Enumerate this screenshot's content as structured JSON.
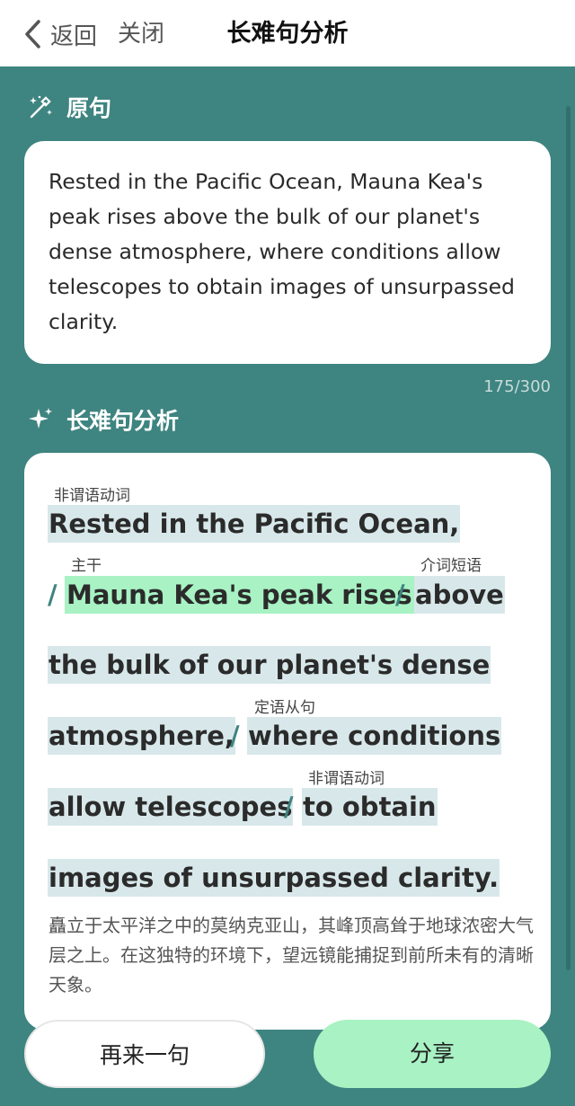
{
  "nav": {
    "back_label": "返回",
    "close_label": "关闭",
    "title": "长难句分析"
  },
  "original": {
    "header": "原句",
    "text": "Rested in the Pacific Ocean, Mauna Kea's peak rises above the bulk of our planet's dense atmosphere, where conditions allow telescopes to obtain images of unsurpassed clarity.",
    "char_count": "175/300"
  },
  "analysis": {
    "header": "长难句分析",
    "tags": {
      "nonfinite_1": "非谓语动词",
      "main_clause": "主干",
      "prep_phrase": "介词短语",
      "attrib_clause": "定语从句",
      "nonfinite_2": "非谓语动词"
    },
    "segments": {
      "s1": "Rested in the Pacific Ocean,",
      "s2": "Mauna Kea's peak rises",
      "s3a": "above",
      "s3b": "the bulk of our planet's dense",
      "s3c": "atmosphere,",
      "s4a": "where conditions",
      "s4b": "allow telescopes",
      "s5a": "to obtain",
      "s5b": "images of unsurpassed clarity."
    },
    "separator": "/",
    "translation": "矗立于太平洋之中的莫纳克亚山，其峰顶高耸于地球浓密大气层之上。在这独特的环境下，望远镜能捕捉到前所未有的清晰天象。"
  },
  "buttons": {
    "again": "再来一句",
    "share": "分享"
  },
  "colors": {
    "background": "#3e8480",
    "main_highlight": "#a8f2c4",
    "segment_highlight": "#d8e8ea"
  }
}
